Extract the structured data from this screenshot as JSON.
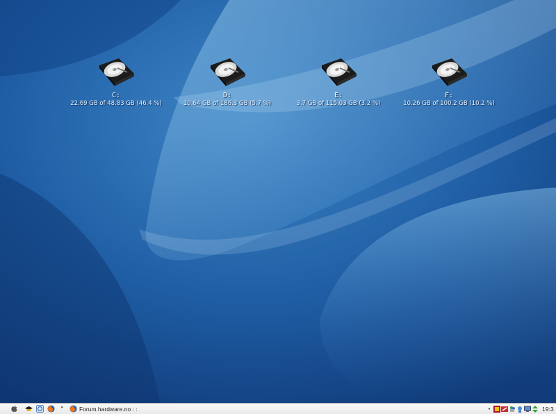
{
  "desktop": {
    "drives": [
      {
        "letter": "C:",
        "usage": "22.69 GB of 48.83 GB (46.4 %)"
      },
      {
        "letter": "D:",
        "usage": "10.64 GB of 186.3 GB (5.7 %)"
      },
      {
        "letter": "E:",
        "usage": "3.7 GB of 115.03 GB (3.2 %)"
      },
      {
        "letter": "F:",
        "usage": "10.26 GB of 100.2 GB (10.2 %)"
      }
    ]
  },
  "taskbar": {
    "quick_launch": [
      "apple-icon",
      "graduation-cap-icon",
      "browser-icon",
      "firefox-icon"
    ],
    "task_button": {
      "label": "Forum.hardware.no : :",
      "icon": "firefox-icon"
    },
    "tray_icons": [
      "media-player-icon",
      "tool-icon",
      "messenger-icon",
      "network-icon",
      "monitor-icon",
      "update-arrows-icon"
    ],
    "clock": "19:3"
  },
  "colors": {
    "wallpaper_base": "#1a4f95",
    "wallpaper_light": "#5aa3d6",
    "taskbar": "#f2f2f2"
  }
}
